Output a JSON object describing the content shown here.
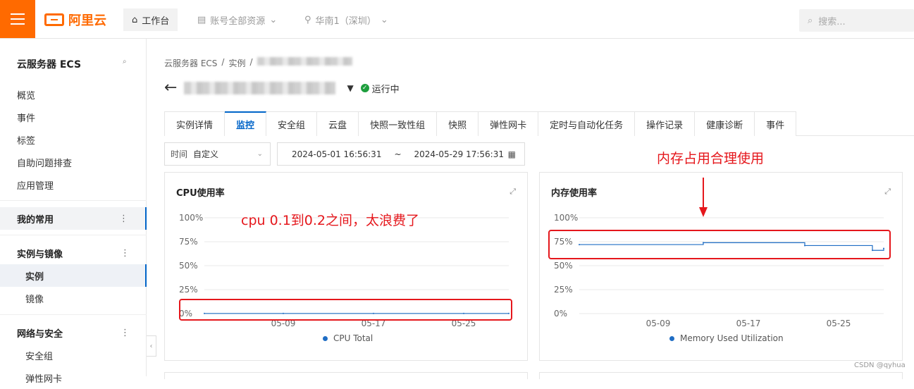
{
  "topbar": {
    "brand": "阿里云",
    "workbench": "工作台",
    "account": "账号全部资源",
    "region": "华南1（深圳）",
    "search_placeholder": "搜索..."
  },
  "sidebar": {
    "title": "云服务器 ECS",
    "items": [
      "概览",
      "事件",
      "标签",
      "自助问题排查",
      "应用管理"
    ],
    "sections": {
      "favorites": "我的常用",
      "instances": "实例与镜像",
      "instance": "实例",
      "image": "镜像",
      "network": "网络与安全",
      "security_group": "安全组",
      "eni": "弹性网卡"
    }
  },
  "breadcrumb": [
    "云服务器 ECS",
    "/",
    "实例",
    "/"
  ],
  "instance": {
    "status": "运行中"
  },
  "tabs": [
    "实例详情",
    "监控",
    "安全组",
    "云盘",
    "快照一致性组",
    "快照",
    "弹性网卡",
    "定时与自动化任务",
    "操作记录",
    "健康诊断",
    "事件"
  ],
  "active_tab": "监控",
  "filter": {
    "time_label": "时间",
    "time_value": "自定义",
    "start": "2024-05-01 16:56:31",
    "separator": "~",
    "end": "2024-05-29 17:56:31"
  },
  "annotations": {
    "cpu": "cpu 0.1到0.2之间，太浪费了",
    "memory": "内存占用合理使用"
  },
  "watermark": "CSDN @qyhua",
  "chart_data": [
    {
      "type": "line",
      "title": "CPU使用率",
      "ylim": [
        0,
        100
      ],
      "y_ticks": [
        "100%",
        "75%",
        "50%",
        "25%",
        "0%"
      ],
      "x_ticks": [
        "05-09",
        "05-17",
        "05-25"
      ],
      "series": [
        {
          "name": "CPU Total",
          "x": [
            "05-02",
            "05-09",
            "05-17",
            "05-25",
            "05-29"
          ],
          "values": [
            0.15,
            0.15,
            0.15,
            0.15,
            0.15
          ]
        }
      ],
      "color": "#1f6dc4"
    },
    {
      "type": "line",
      "title": "内存使用率",
      "ylim": [
        0,
        100
      ],
      "y_ticks": [
        "100%",
        "75%",
        "50%",
        "25%",
        "0%"
      ],
      "x_ticks": [
        "05-09",
        "05-17",
        "05-25"
      ],
      "series": [
        {
          "name": "Memory Used Utilization",
          "x": [
            "05-02",
            "05-13",
            "05-22",
            "05-28",
            "05-29"
          ],
          "values": [
            72,
            74,
            71,
            66,
            68
          ]
        }
      ],
      "color": "#1f6dc4"
    }
  ]
}
